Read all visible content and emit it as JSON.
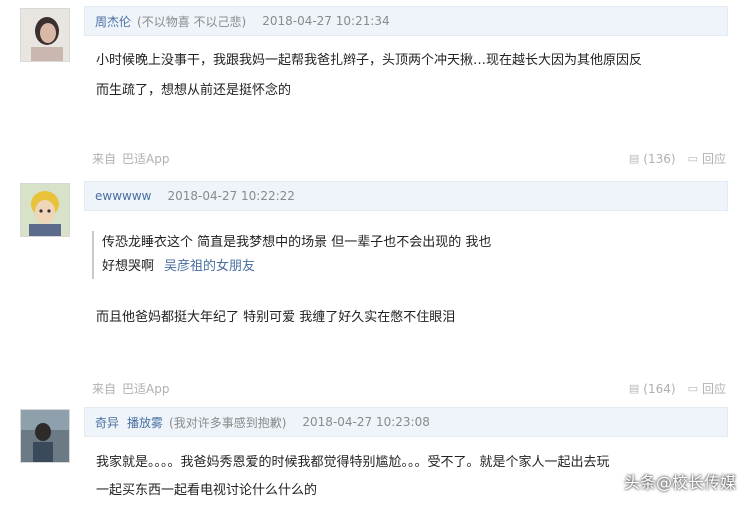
{
  "comments": [
    {
      "user": "周杰伦",
      "note": "(不以物喜 不以己悲)",
      "time": "2018-04-27 10:21:34",
      "lines": [
        "小时候晚上没事干，我跟我妈一起帮我爸扎辫子，头顶两个冲天揪…现在越长大因为其他原因反",
        "而生疏了，想想从前还是挺怀念的"
      ],
      "source_prefix": "来自",
      "source_app": "巴适App",
      "likes": "(136)",
      "reply_label": "回应"
    },
    {
      "user": "ewwwww",
      "note": "",
      "time": "2018-04-27 10:22:22",
      "quote_lines": [
        "传恐龙睡衣这个 简直是我梦想中的场景 但一辈子也不会出现的 我也",
        "好想哭啊"
      ],
      "quote_author": "吴彦祖的女朋友",
      "lines": [
        "而且他爸妈都挺大年纪了 特别可爱 我缠了好久实在憋不住眼泪"
      ],
      "source_prefix": "来自",
      "source_app": "巴适App",
      "likes": "(164)",
      "reply_label": "回应"
    },
    {
      "user": "奇异",
      "user2": "播放雾",
      "note": "(我对许多事感到抱歉)",
      "time": "2018-04-27 10:23:08",
      "lines": [
        "我家就是。。。。我爸妈秀恩爱的时候我都觉得特别尴尬。。。受不了。就是个家人一起出去玩",
        "一起买东西一起看电视讨论什么什么的"
      ]
    }
  ],
  "watermark": "头条@校长传媒",
  "icons": {
    "like": "thumbs-icon",
    "reply": "reply-icon"
  }
}
